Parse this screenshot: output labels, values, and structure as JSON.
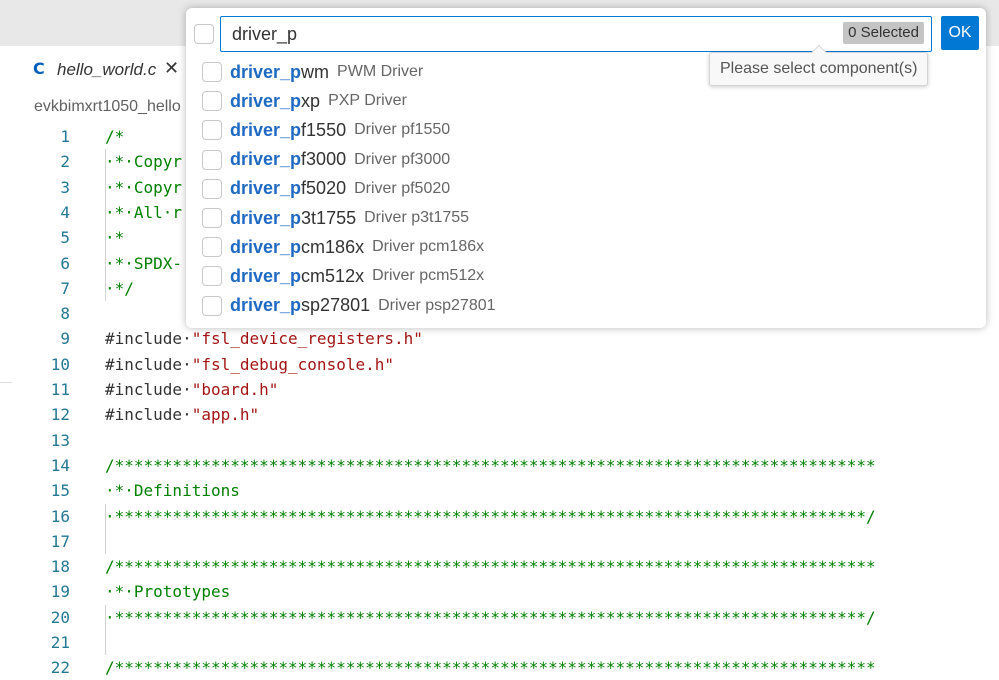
{
  "tab": {
    "language_icon": "C",
    "file_name": "hello_world.c",
    "close_glyph": "✕"
  },
  "breadcrumb": {
    "text": "evkbimxrt1050_hello"
  },
  "picker": {
    "input_value": "driver_p",
    "selected_count": "0 Selected",
    "ok_label": "OK",
    "tooltip": "Please select component(s)",
    "items": [
      {
        "match": "driver_p",
        "rest": "wm",
        "description": "PWM Driver"
      },
      {
        "match": "driver_p",
        "rest": "xp",
        "description": "PXP Driver"
      },
      {
        "match": "driver_p",
        "rest": "f1550",
        "description": "Driver pf1550"
      },
      {
        "match": "driver_p",
        "rest": "f3000",
        "description": "Driver pf3000"
      },
      {
        "match": "driver_p",
        "rest": "f5020",
        "description": "Driver pf5020"
      },
      {
        "match": "driver_p",
        "rest": "3t1755",
        "description": "Driver p3t1755"
      },
      {
        "match": "driver_p",
        "rest": "cm186x",
        "description": "Driver pcm186x"
      },
      {
        "match": "driver_p",
        "rest": "cm512x",
        "description": "Driver pcm512x"
      },
      {
        "match": "driver_p",
        "rest": "sp27801",
        "description": "Driver psp27801"
      }
    ]
  },
  "code_lines": [
    {
      "n": "1",
      "text": "/*"
    },
    {
      "n": "2",
      "text": "·*·Copyr"
    },
    {
      "n": "3",
      "text": "·*·Copyr"
    },
    {
      "n": "4",
      "text": "·*·All·r"
    },
    {
      "n": "5",
      "text": "·*"
    },
    {
      "n": "6",
      "text": "·*·SPDX-"
    },
    {
      "n": "7",
      "text": "·*/"
    },
    {
      "n": "8",
      "text": ""
    },
    {
      "n": "9",
      "kw": "#include·",
      "str": "\"fsl_device_registers.h\""
    },
    {
      "n": "10",
      "kw": "#include·",
      "str": "\"fsl_debug_console.h\""
    },
    {
      "n": "11",
      "kw": "#include·",
      "str": "\"board.h\""
    },
    {
      "n": "12",
      "kw": "#include·",
      "str": "\"app.h\""
    },
    {
      "n": "13",
      "text": ""
    },
    {
      "n": "14",
      "text": "/*******************************************************************************"
    },
    {
      "n": "15",
      "text": "·*·Definitions"
    },
    {
      "n": "16",
      "text": "·******************************************************************************/"
    },
    {
      "n": "17",
      "text": ""
    },
    {
      "n": "18",
      "text": "/*******************************************************************************"
    },
    {
      "n": "19",
      "text": "·*·Prototypes"
    },
    {
      "n": "20",
      "text": "·******************************************************************************/"
    },
    {
      "n": "21",
      "text": ""
    },
    {
      "n": "22",
      "text": "/*******************************************************************************"
    }
  ]
}
